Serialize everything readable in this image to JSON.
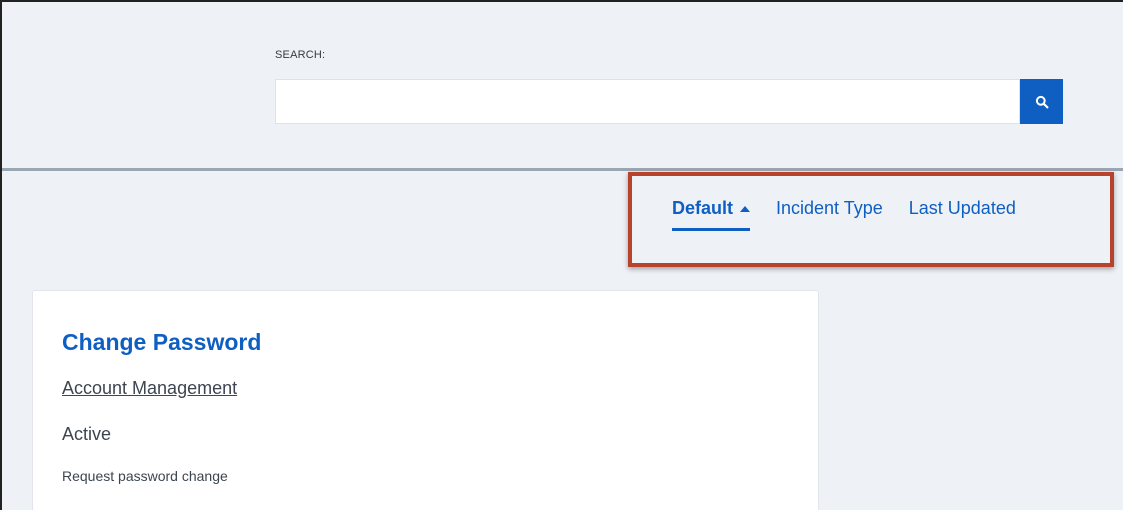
{
  "search": {
    "label": "SEARCH:",
    "value": "",
    "placeholder": "",
    "button_icon": "search-icon"
  },
  "sort": {
    "options": [
      {
        "label": "Default",
        "active": true,
        "direction": "ascending"
      },
      {
        "label": "Incident Type",
        "active": false
      },
      {
        "label": "Last Updated",
        "active": false
      }
    ]
  },
  "card": {
    "title": "Change Password",
    "category": "Account Management",
    "status": "Active",
    "description": "Request password change"
  },
  "colors": {
    "accent": "#0f5fc2",
    "background": "#eef1f6",
    "highlight": "#b8432c"
  }
}
